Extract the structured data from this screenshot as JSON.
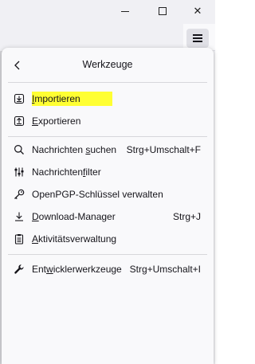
{
  "window": {
    "minimize_glyph": "—",
    "maximize_glyph": "□",
    "close_glyph": "✕"
  },
  "panel": {
    "title": "Werkzeuge",
    "back_icon": "chevron-left-icon"
  },
  "menu": {
    "items": [
      {
        "id": "import",
        "pre": "",
        "accel": "I",
        "post": "mportieren",
        "shortcut": "",
        "icon": "import-icon"
      },
      {
        "id": "export",
        "pre": "",
        "accel": "E",
        "post": "xportieren",
        "shortcut": "",
        "icon": "export-icon"
      },
      {
        "id": "search",
        "pre": "Nachrichten ",
        "accel": "s",
        "post": "uchen",
        "shortcut": "Strg+Umschalt+F",
        "icon": "search-icon"
      },
      {
        "id": "filter",
        "pre": "Nachrichten",
        "accel": "f",
        "post": "ilter",
        "shortcut": "",
        "icon": "filter-sliders-icon"
      },
      {
        "id": "openpgp",
        "pre": "OpenPGP-Schlüssel verwalten",
        "accel": "",
        "post": "",
        "shortcut": "",
        "icon": "key-icon"
      },
      {
        "id": "download",
        "pre": "",
        "accel": "D",
        "post": "ownload-Manager",
        "shortcut": "Strg+J",
        "icon": "download-icon"
      },
      {
        "id": "activity",
        "pre": "",
        "accel": "A",
        "post": "ktivitätsverwaltung",
        "shortcut": "",
        "icon": "clipboard-icon"
      },
      {
        "id": "devtools",
        "pre": "Ent",
        "accel": "w",
        "post": "icklerwerkzeuge",
        "shortcut": "Strg+Umschalt+I",
        "icon": "wrench-icon"
      }
    ]
  },
  "colors": {
    "highlight": "#ffff33",
    "panel_bg": "#f9f9fb",
    "separator": "#d7d7db"
  }
}
